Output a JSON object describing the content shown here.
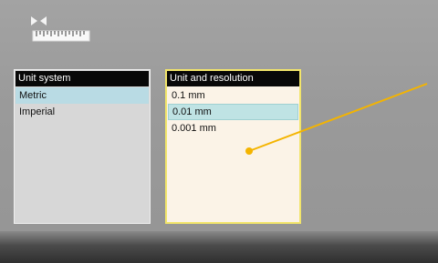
{
  "icons": {
    "ruler": "ruler-measure-icon"
  },
  "unit_system_panel": {
    "title": "Unit system",
    "items": [
      {
        "label": "Metric",
        "selected": true
      },
      {
        "label": "Imperial",
        "selected": false
      }
    ]
  },
  "unit_resolution_panel": {
    "title": "Unit and resolution",
    "items": [
      {
        "label": "0.1 mm",
        "selected": false
      },
      {
        "label": "0.01 mm",
        "selected": true
      },
      {
        "label": "0.001 mm",
        "selected": false
      }
    ]
  },
  "colors": {
    "highlight_border": "#f2e56a",
    "pointer": "#f4b400",
    "selected_row": "#b9dbe4",
    "header_bg": "#080808"
  }
}
